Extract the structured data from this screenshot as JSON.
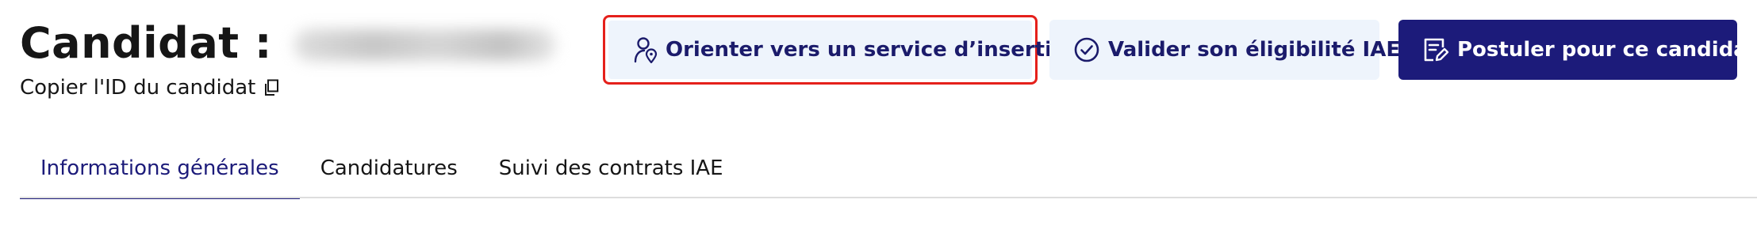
{
  "header": {
    "title": "Candidat :",
    "copy_id_label": "Copier l'ID du candidat"
  },
  "actions": {
    "orienter_label": "Orienter vers un service d’insertion",
    "valider_label": "Valider son éligibilité IAE",
    "postuler_label": "Postuler pour ce candidat"
  },
  "tabs": [
    {
      "label": "Informations générales",
      "active": true
    },
    {
      "label": "Candidatures",
      "active": false
    },
    {
      "label": "Suivi des contrats IAE",
      "active": false
    }
  ],
  "colors": {
    "primary": "#1c1b7a",
    "secondary_bg": "#eef4fc",
    "highlight": "#e5201b"
  },
  "icons": {
    "orienter": "user-location-icon",
    "valider": "check-circle-icon",
    "postuler": "edit-document-icon",
    "copy": "copy-icon"
  }
}
